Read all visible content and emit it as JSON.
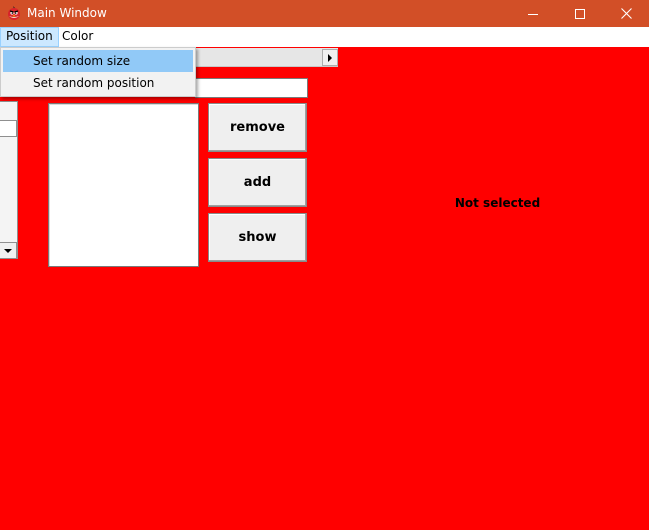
{
  "window": {
    "title": "Main Window",
    "app_icon": "angry-bird-icon",
    "controls": [
      "minimize-icon",
      "maximize-icon",
      "close-icon"
    ],
    "title_bar_color": "#d24f27"
  },
  "menubar": {
    "items": [
      {
        "label": "Position",
        "open": true
      },
      {
        "label": "Color",
        "open": false
      }
    ]
  },
  "dropdown": {
    "items": [
      {
        "label": "Set random size",
        "highlighted": true
      },
      {
        "label": "Set random position",
        "highlighted": false
      }
    ]
  },
  "main": {
    "background_color": "#ff0000",
    "line_edit_value": "",
    "list_items": [],
    "buttons": {
      "remove": "remove",
      "add": "add",
      "show": "show"
    },
    "status_label": "Not selected"
  }
}
